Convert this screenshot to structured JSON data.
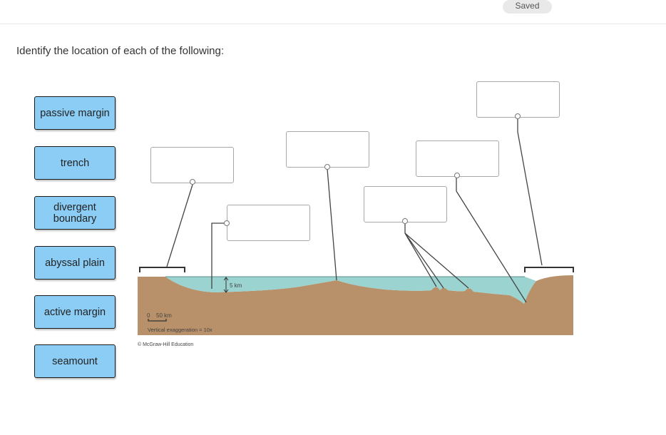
{
  "status": {
    "saved_label": "Saved"
  },
  "question": {
    "prompt": "Identify the location of each of the following:"
  },
  "answer_chips": [
    {
      "label": "passive margin"
    },
    {
      "label": "trench"
    },
    {
      "label": "divergent boundary"
    },
    {
      "label": "abyssal plain"
    },
    {
      "label": "active margin"
    },
    {
      "label": "seamount"
    }
  ],
  "diagram": {
    "depth_scale_label": "5 km",
    "horizontal_scale_zero": "0",
    "horizontal_scale_label": "50 km",
    "vertical_exaggeration": "Vertical exaggeration = 10x",
    "credit": "© McGraw-Hill Education",
    "colors": {
      "water": "#9ad3cf",
      "seafloor": "#b8916a",
      "chip": "#8ccdf5"
    }
  }
}
